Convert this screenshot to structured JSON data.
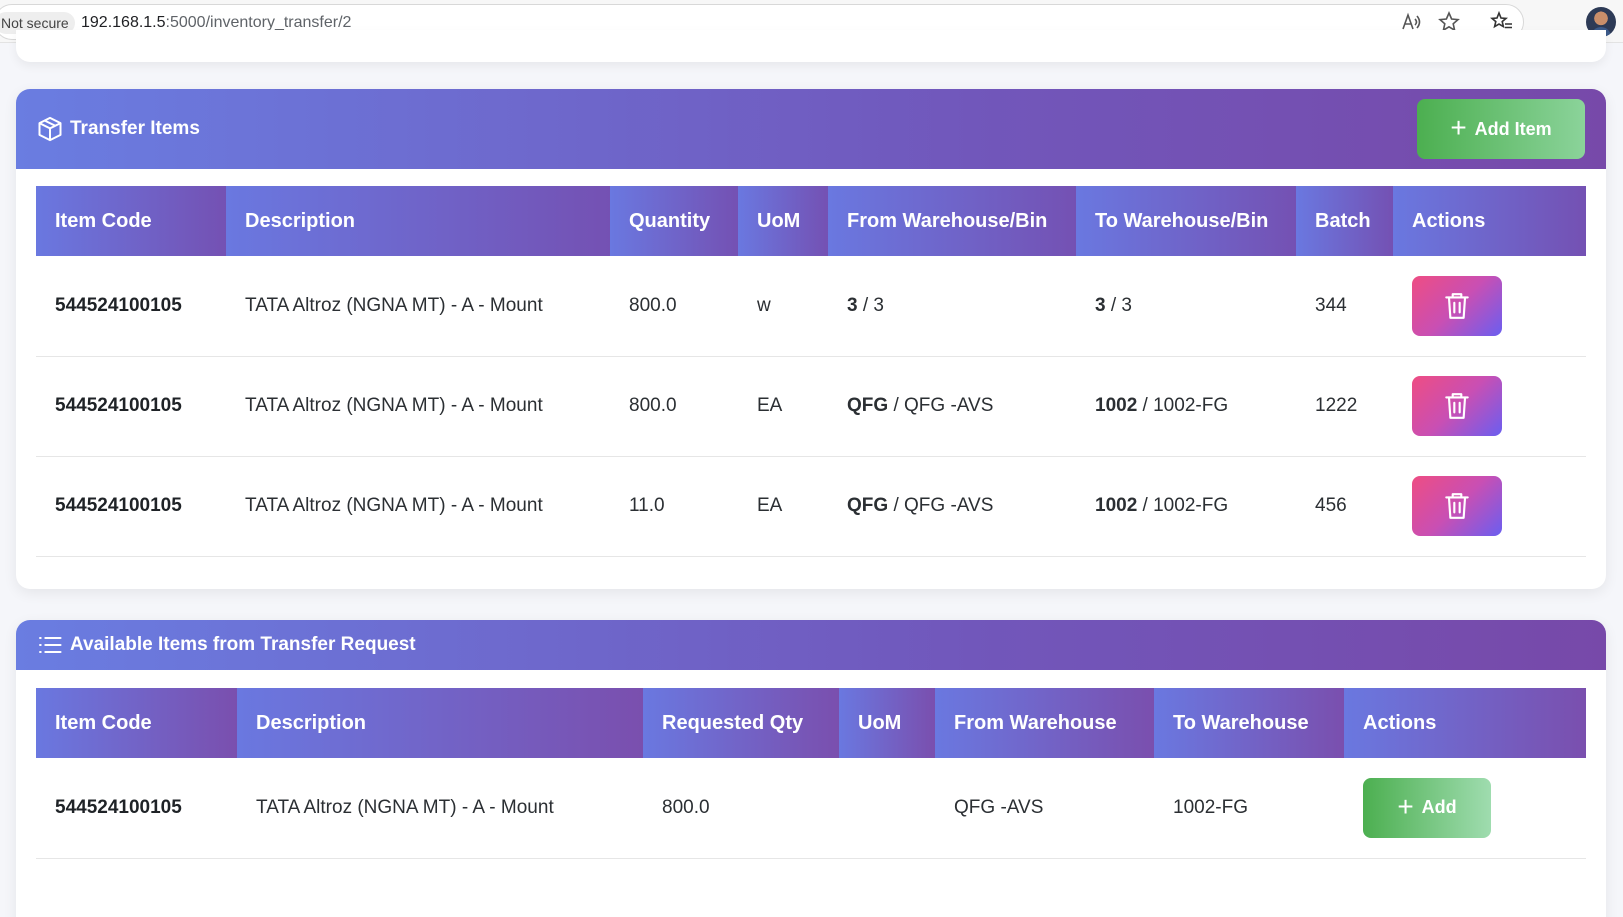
{
  "browser": {
    "security_label": "Not secure",
    "url_host": "192.168.1.5",
    "url_path": ":5000/inventory_transfer/2",
    "icons": [
      "read-aloud-icon",
      "favorite-star-icon",
      "favorites-list-icon",
      "profile-avatar"
    ]
  },
  "transfer_items": {
    "title": "Transfer Items",
    "add_button_label": "Add Item",
    "columns": [
      "Item Code",
      "Description",
      "Quantity",
      "UoM",
      "From Warehouse/Bin",
      "To Warehouse/Bin",
      "Batch",
      "Actions"
    ],
    "rows": [
      {
        "item_code": "544524100105",
        "description": "TATA Altroz (NGNA MT) - A - Mount",
        "quantity": "800.0",
        "uom": "w",
        "from_warehouse": "3",
        "from_bin": " / 3",
        "to_warehouse": "3",
        "to_bin": " / 3",
        "batch": "344"
      },
      {
        "item_code": "544524100105",
        "description": "TATA Altroz (NGNA MT) - A - Mount",
        "quantity": "800.0",
        "uom": "EA",
        "from_warehouse": "QFG",
        "from_bin": " / QFG -AVS",
        "to_warehouse": "1002",
        "to_bin": " / 1002-FG",
        "batch": "1222"
      },
      {
        "item_code": "544524100105",
        "description": "TATA Altroz (NGNA MT) - A - Mount",
        "quantity": "11.0",
        "uom": "EA",
        "from_warehouse": "QFG",
        "from_bin": " / QFG -AVS",
        "to_warehouse": "1002",
        "to_bin": " / 1002-FG",
        "batch": "456"
      }
    ]
  },
  "available_items": {
    "title": "Available Items from Transfer Request",
    "columns": [
      "Item Code",
      "Description",
      "Requested Qty",
      "UoM",
      "From Warehouse",
      "To Warehouse",
      "Actions"
    ],
    "rows": [
      {
        "item_code": "544524100105",
        "description": "TATA Altroz (NGNA MT) - A - Mount",
        "requested_qty": "800.0",
        "uom": "",
        "from_warehouse": "QFG -AVS",
        "to_warehouse": "1002-FG",
        "action_label": "Add"
      }
    ]
  },
  "colors": {
    "header_gradient_start": "#6a7de1",
    "header_gradient_end": "#7749a9",
    "add_green": "#4caf50",
    "delete_pink": "#ee4d83",
    "delete_blue": "#6a5ef0"
  }
}
